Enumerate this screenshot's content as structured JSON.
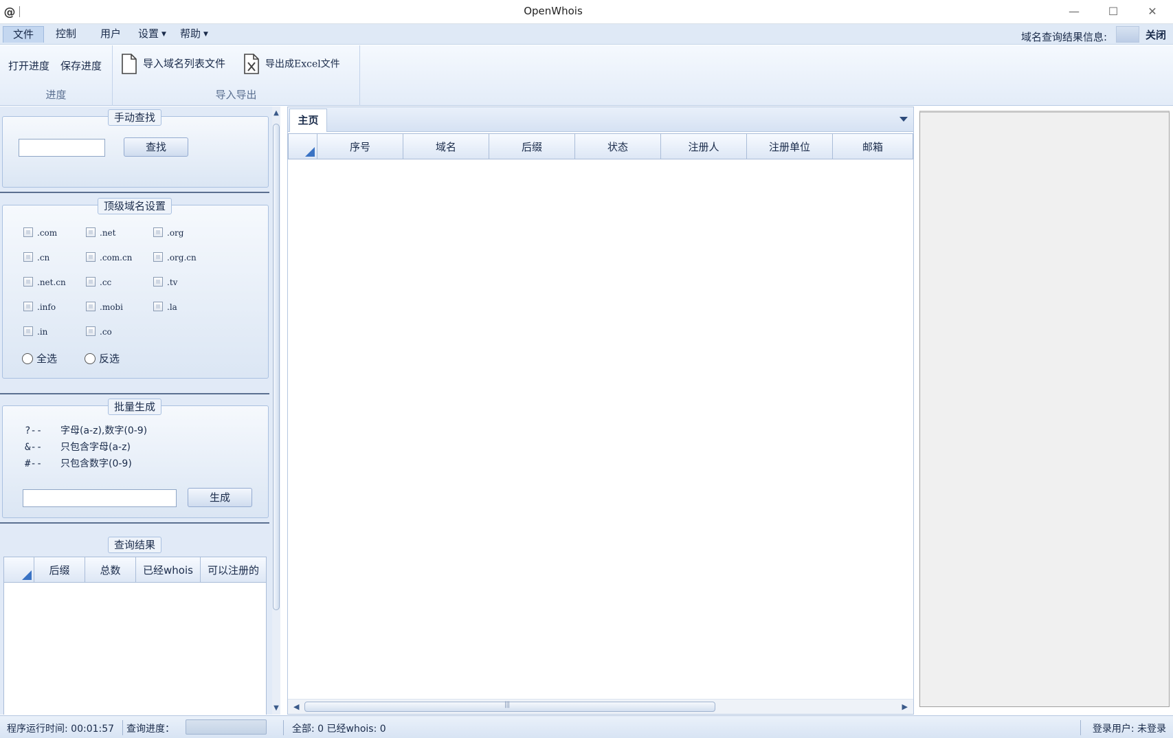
{
  "window": {
    "title": "OpenWhois",
    "app_icon": "@",
    "controls": {
      "minimize": "—",
      "maximize": "☐",
      "close": "✕"
    }
  },
  "menubar": {
    "items": [
      {
        "label": "文件",
        "active": true
      },
      {
        "label": "控制"
      },
      {
        "label": "用户"
      },
      {
        "label": "设置",
        "arrow": "▼"
      },
      {
        "label": "帮助",
        "arrow": "▼"
      }
    ],
    "info_label": "域名查询结果信息:",
    "close_label": "关闭"
  },
  "ribbon": {
    "groups": [
      {
        "label": "进度",
        "buttons": [
          "打开进度",
          "保存进度"
        ]
      },
      {
        "label": "导入导出",
        "buttons": [
          "导入域名列表文件",
          "导出成Excel文件"
        ]
      }
    ]
  },
  "manual_search": {
    "legend": "手动查找",
    "input_value": "",
    "button": "查找"
  },
  "tld_settings": {
    "legend": "顶级域名设置",
    "tlds": [
      ".com",
      ".net",
      ".org",
      ".cn",
      ".com.cn",
      ".org.cn",
      ".net.cn",
      ".cc",
      ".tv",
      ".info",
      ".mobi",
      ".la",
      ".in",
      ".co"
    ],
    "radio_all": "全选",
    "radio_invert": "反选"
  },
  "batch": {
    "legend": "批量生成",
    "rules": [
      {
        "symbol": "?--",
        "text": "字母(a-z),数字(0-9)"
      },
      {
        "symbol": "&--",
        "text": "只包含字母(a-z)"
      },
      {
        "symbol": "#--",
        "text": "只包含数字(0-9)"
      }
    ],
    "input_value": "",
    "button": "生成"
  },
  "results": {
    "legend": "查询结果",
    "columns": [
      "后缀",
      "总数",
      "已经whois",
      "可以注册的"
    ]
  },
  "main": {
    "tab": "主页",
    "columns": [
      "序号",
      "域名",
      "后缀",
      "状态",
      "注册人",
      "注册单位",
      "邮箱"
    ]
  },
  "status": {
    "runtime": "程序运行时间: 00:01:57",
    "progress_label": "查询进度：",
    "progress_value": 0,
    "counts": "全部: 0  已经whois: 0",
    "login": "登录用户: 未登录"
  }
}
